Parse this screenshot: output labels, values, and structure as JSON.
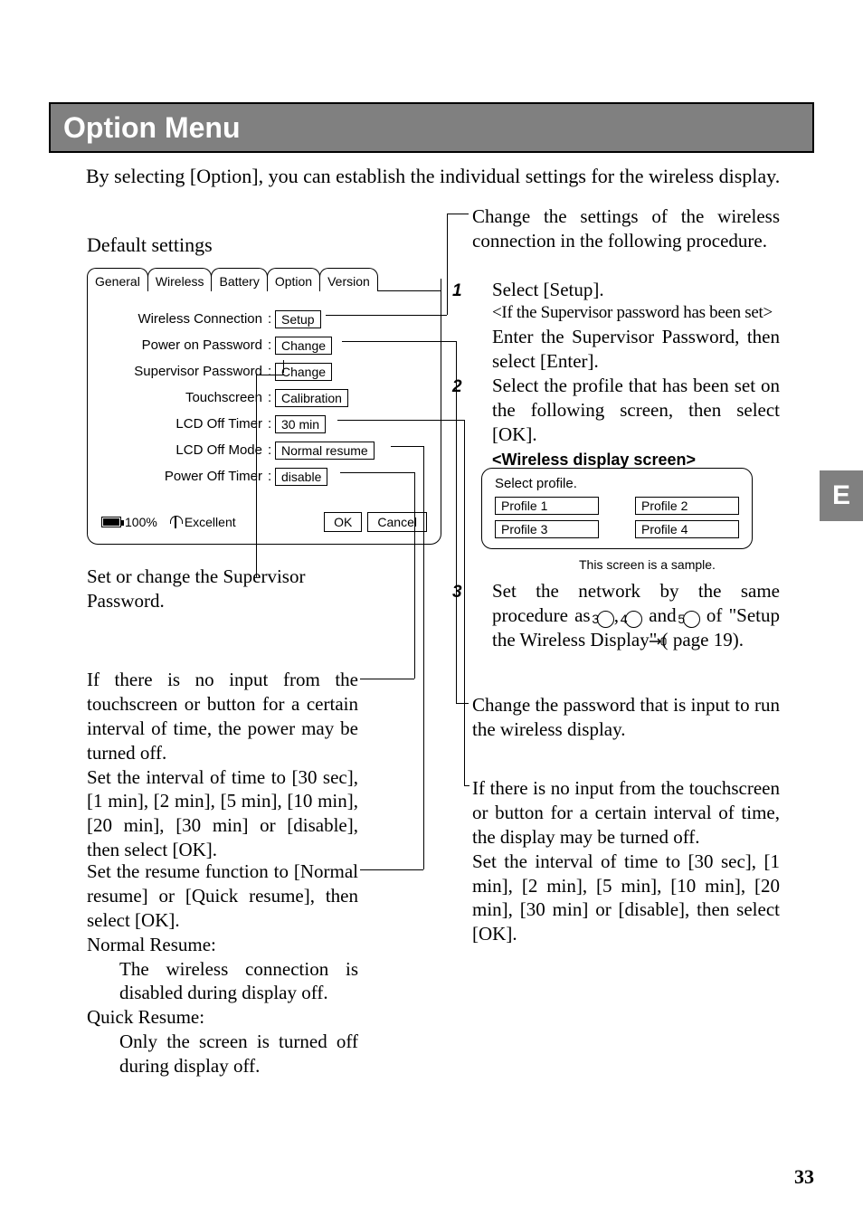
{
  "header": {
    "title": "Option Menu"
  },
  "intro": "By selecting [Option], you can establish the individual settings for the wireless display.",
  "default_label": "Default settings",
  "tabs": [
    "General",
    "Wireless",
    "Battery",
    "Option",
    "Version"
  ],
  "active_tab_index": 3,
  "option_rows": {
    "wireless_connection": {
      "label": "Wireless Connection",
      "value": "Setup"
    },
    "power_on_password": {
      "label": "Power on Password",
      "value": "Change"
    },
    "supervisor_password": {
      "label": "Supervisor Password",
      "value": "Change"
    },
    "touchscreen": {
      "label": "Touchscreen",
      "value": "Calibration"
    },
    "lcd_off_timer": {
      "label": "LCD Off Timer",
      "value": "30 min"
    },
    "lcd_off_mode": {
      "label": "LCD Off Mode",
      "value": "Normal resume"
    },
    "power_off_timer": {
      "label": "Power Off Timer",
      "value": "disable"
    }
  },
  "status": {
    "battery_pct": "100%",
    "signal_label": "Excellent"
  },
  "buttons": {
    "ok": "OK",
    "cancel": "Cancel"
  },
  "right": {
    "conn_intro": "Change the settings of the wireless connection in the following procedure.",
    "step1_label": "1",
    "step1_text": "Select [Setup].",
    "step1_cond": "<If the Supervisor password has been set>",
    "step1_sub": "Enter the Supervisor Password, then select [Enter].",
    "step2_label": "2",
    "step2_text": "Select the profile that has been set on the following screen, then select [OK].",
    "screen_head": "<Wireless display screen>",
    "profile_title": "Select profile.",
    "profiles": [
      "Profile 1",
      "Profile 2",
      "Profile 3",
      "Profile 4"
    ],
    "sample_note": "This screen is a sample.",
    "step3_label": "3",
    "step3_a": "Set the network by the same procedure as ",
    "step3_b": " of \"Setup the Wireless Display\" (",
    "step3_c": " page 19).",
    "password_block": "Change the password that is input to run the wireless display.",
    "lcd_block": "If there is no input from the touchscreen or button for a certain interval of time, the display may be turned off.\nSet the interval of time to [30 sec], [1 min], [2 min], [5 min], [10 min], [20 min], [30 min] or [disable], then select [OK]."
  },
  "left": {
    "supervisor_note": "Set or change the Supervisor Password.",
    "poweroff_block": "If there is no input from the touchscreen or button for a certain interval of time, the power may be turned off.\nSet the interval of time to [30 sec], [1 min], [2 min], [5 min], [10 min], [20 min], [30 min] or [disable], then select [OK].",
    "resume_intro": "Set the resume function to [Normal resume] or [Quick resume], then select [OK].",
    "normal_head": "Normal Resume:",
    "normal_body": "The wireless connection is disabled during display off.",
    "quick_head": "Quick Resume:",
    "quick_body": "Only the screen is turned off during display off."
  },
  "side_tab": "E",
  "page_number": "33"
}
